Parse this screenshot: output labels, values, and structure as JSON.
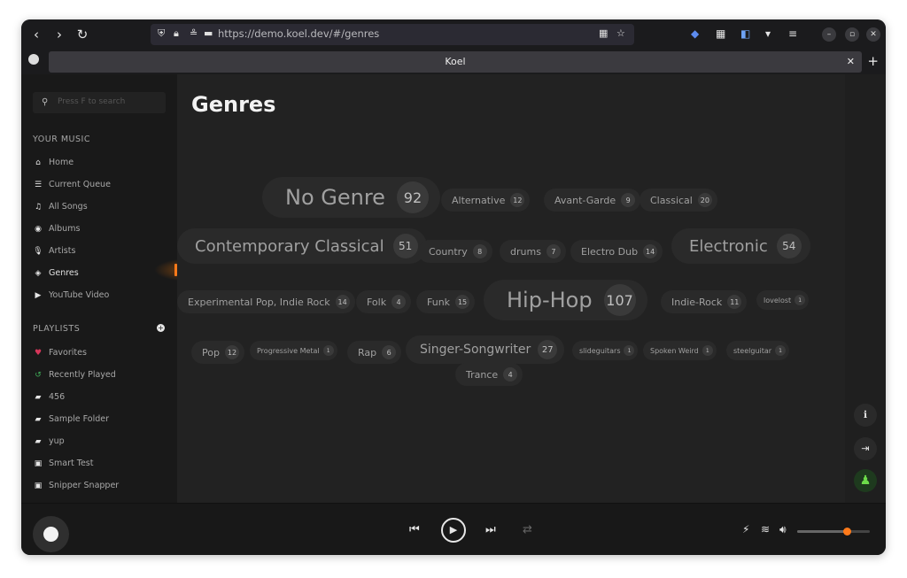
{
  "browser": {
    "url": "https://demo.koel.dev/#/genres",
    "tab_title": "Koel",
    "icons": [
      "back-icon",
      "forward-icon",
      "reload-icon",
      "shield-icon",
      "lock-icon",
      "qr-icon",
      "star-icon"
    ]
  },
  "sidebar": {
    "search_placeholder": "Press F to search",
    "your_music_heading": "YOUR MUSIC",
    "your_music": [
      {
        "label": "Home",
        "icon": "home-icon"
      },
      {
        "label": "Current Queue",
        "icon": "queue-icon"
      },
      {
        "label": "All Songs",
        "icon": "music-note-icon"
      },
      {
        "label": "Albums",
        "icon": "disc-icon"
      },
      {
        "label": "Artists",
        "icon": "microphone-icon"
      },
      {
        "label": "Genres",
        "icon": "tag-icon",
        "active": true
      },
      {
        "label": "YouTube Video",
        "icon": "youtube-icon"
      }
    ],
    "playlists_heading": "PLAYLISTS",
    "playlists": [
      {
        "label": "Favorites",
        "icon": "heart-icon",
        "color": "#d6365a"
      },
      {
        "label": "Recently Played",
        "icon": "history-icon",
        "color": "#40b05a"
      },
      {
        "label": "456",
        "icon": "folder-icon"
      },
      {
        "label": "Sample Folder",
        "icon": "folder-icon"
      },
      {
        "label": "yup",
        "icon": "folder-icon"
      },
      {
        "label": "Smart Test",
        "icon": "smart-playlist-icon"
      },
      {
        "label": "Snipper Snapper",
        "icon": "smart-playlist-icon"
      }
    ]
  },
  "main": {
    "title": "Genres",
    "genres": [
      {
        "name": "No Genre",
        "count": "92",
        "size": "xl"
      },
      {
        "name": "Alternative",
        "count": "12",
        "size": "sm"
      },
      {
        "name": "Avant-Garde",
        "count": "9",
        "size": "sm"
      },
      {
        "name": "Classical",
        "count": "20",
        "size": "sm"
      },
      {
        "name": "Contemporary Classical",
        "count": "51",
        "size": "lg"
      },
      {
        "name": "Country",
        "count": "8",
        "size": "sm"
      },
      {
        "name": "drums",
        "count": "7",
        "size": "sm"
      },
      {
        "name": "Electro Dub",
        "count": "14",
        "size": "sm"
      },
      {
        "name": "Electronic",
        "count": "54",
        "size": "lg"
      },
      {
        "name": "Experimental Pop, Indie Rock",
        "count": "14",
        "size": "sm"
      },
      {
        "name": "Folk",
        "count": "4",
        "size": "sm"
      },
      {
        "name": "Funk",
        "count": "15",
        "size": "sm"
      },
      {
        "name": "Hip-Hop",
        "count": "107",
        "size": "xl"
      },
      {
        "name": "Indie-Rock",
        "count": "11",
        "size": "sm"
      },
      {
        "name": "lovelost",
        "count": "1",
        "size": "xs"
      },
      {
        "name": "Pop",
        "count": "12",
        "size": "sm"
      },
      {
        "name": "Progressive Metal",
        "count": "1",
        "size": "xs"
      },
      {
        "name": "Rap",
        "count": "6",
        "size": "sm"
      },
      {
        "name": "Singer-Songwriter",
        "count": "27",
        "size": "md"
      },
      {
        "name": "slideguitars",
        "count": "1",
        "size": "xs"
      },
      {
        "name": "Spoken Weird",
        "count": "1",
        "size": "xs"
      },
      {
        "name": "steelguitar",
        "count": "1",
        "size": "xs"
      },
      {
        "name": "Trance",
        "count": "4",
        "size": "sm"
      }
    ]
  },
  "player": {
    "volume": 0.68,
    "accent_color": "#ff7a1a"
  }
}
